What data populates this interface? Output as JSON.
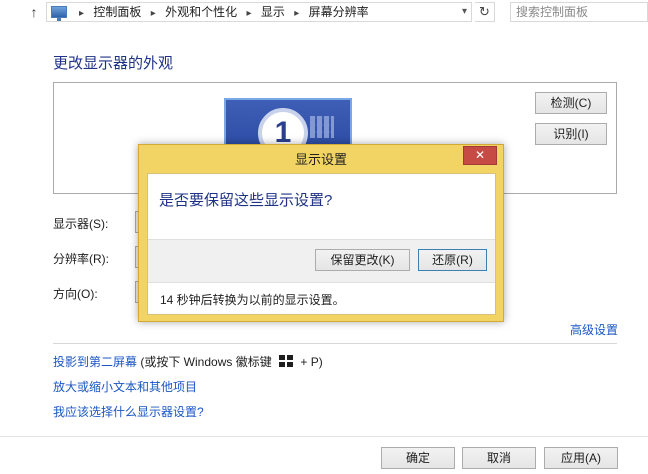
{
  "address_bar": {
    "breadcrumbs": [
      "控制面板",
      "外观和个性化",
      "显示",
      "屏幕分辨率"
    ],
    "search_placeholder": "搜索控制面板"
  },
  "page": {
    "title": "更改显示器的外观",
    "monitor_number": "1",
    "detect_button": "检测(C)",
    "identify_button": "识别(I)",
    "display_label": "显示器(S):",
    "resolution_label": "分辨率(R):",
    "orientation_label": "方向(O):",
    "advanced_link": "高级设置",
    "links": {
      "project": "投影到第二屏幕",
      "project_hint_pre": " (或按下 Windows 徽标键 ",
      "project_hint_post": " + P)",
      "text_size": "放大或缩小文本和其他项目",
      "which_settings": "我应该选择什么显示器设置?"
    },
    "ok_button": "确定",
    "cancel_button": "取消",
    "apply_button": "应用(A)"
  },
  "dialog": {
    "title": "显示设置",
    "close_glyph": "✕",
    "question": "是否要保留这些显示设置?",
    "keep_button": "保留更改(K)",
    "revert_button": "还原(R)",
    "countdown_note": "14 秒钟后转换为以前的显示设置。"
  },
  "colors": {
    "dialog_frame": "#f2d464",
    "link": "#1a57c4",
    "heading": "#1e3287",
    "close_button": "#c74b45"
  }
}
